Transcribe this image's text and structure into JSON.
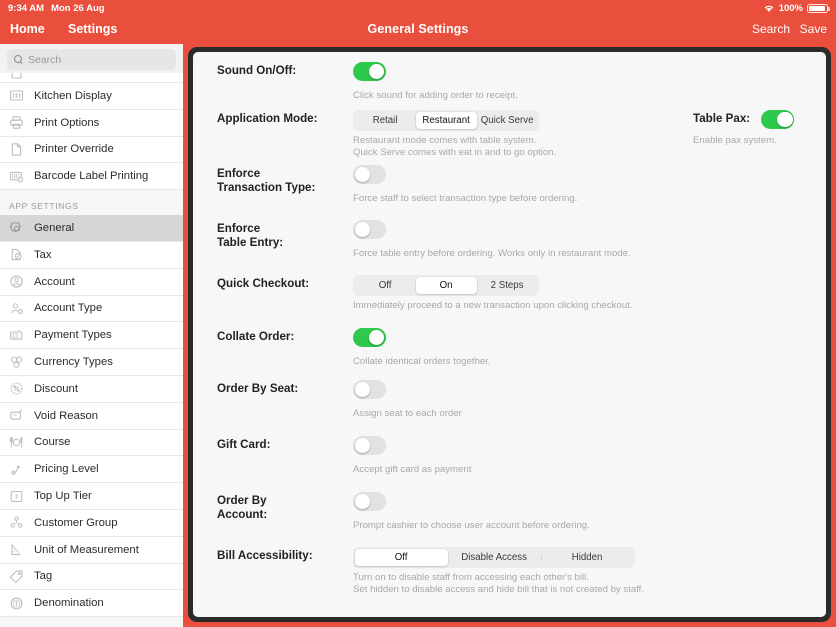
{
  "statusbar": {
    "time": "9:34 AM",
    "date": "Mon 26 Aug",
    "battery_percent": "100%",
    "wifi_icon": "wifi-icon",
    "battery_icon": "battery-icon"
  },
  "topbar": {
    "home_label": "Home",
    "settings_label": "Settings",
    "title": "General Settings",
    "search_label": "Search",
    "save_label": "Save",
    "accent_color": "#e94f3c"
  },
  "sidebar": {
    "search": {
      "placeholder": "Search",
      "icon": "search-icon"
    },
    "items": [
      {
        "label": "Kitchen Display",
        "icon": "kitchen-display-icon",
        "selected": false
      },
      {
        "label": "Print Options",
        "icon": "printer-icon",
        "selected": false
      },
      {
        "label": "Printer Override",
        "icon": "document-icon",
        "selected": false
      },
      {
        "label": "Barcode Label Printing",
        "icon": "barcode-icon",
        "selected": false
      }
    ],
    "group_label": "APP SETTINGS",
    "app_items": [
      {
        "label": "General",
        "icon": "gear-icon",
        "selected": true
      },
      {
        "label": "Tax",
        "icon": "tax-icon",
        "selected": false
      },
      {
        "label": "Account",
        "icon": "account-icon",
        "selected": false
      },
      {
        "label": "Account Type",
        "icon": "account-type-icon",
        "selected": false
      },
      {
        "label": "Payment Types",
        "icon": "payment-icon",
        "selected": false
      },
      {
        "label": "Currency Types",
        "icon": "currency-icon",
        "selected": false
      },
      {
        "label": "Discount",
        "icon": "discount-icon",
        "selected": false
      },
      {
        "label": "Void Reason",
        "icon": "void-reason-icon",
        "selected": false
      },
      {
        "label": "Course",
        "icon": "course-icon",
        "selected": false
      },
      {
        "label": "Pricing Level",
        "icon": "pricing-level-icon",
        "selected": false
      },
      {
        "label": "Top Up Tier",
        "icon": "top-up-tier-icon",
        "selected": false
      },
      {
        "label": "Customer Group",
        "icon": "customer-group-icon",
        "selected": false
      },
      {
        "label": "Unit of Measurement",
        "icon": "unit-measurement-icon",
        "selected": false
      },
      {
        "label": "Tag",
        "icon": "tag-icon",
        "selected": false
      },
      {
        "label": "Denomination",
        "icon": "denomination-icon",
        "selected": false
      }
    ]
  },
  "settings": {
    "sound": {
      "label": "Sound On/Off:",
      "help": "Click sound for adding order to receipt.",
      "state": "on"
    },
    "application_mode": {
      "label": "Application Mode:",
      "options": [
        "Retail",
        "Restaurant",
        "Quick Serve"
      ],
      "selected": "Restaurant",
      "help_line1": "Restaurant mode comes with table system.",
      "help_line2": "Quick Serve comes with eat in and to go option."
    },
    "table_pax": {
      "label": "Table Pax:",
      "help": "Enable pax system.",
      "state": "on"
    },
    "enforce_transaction_type": {
      "label_line1": "Enforce",
      "label_line2": "Transaction Type:",
      "help": "Force staff to select transaction type before ordering.",
      "state": "off"
    },
    "enforce_table_entry": {
      "label_line1": "Enforce",
      "label_line2": "Table Entry:",
      "help": "Force table entry before ordering. Works only in restaurant mode.",
      "state": "off"
    },
    "quick_checkout": {
      "label": "Quick Checkout:",
      "options": [
        "Off",
        "On",
        "2 Steps"
      ],
      "selected": "On",
      "help": "Immediately proceed to a new transaction upon clicking checkout."
    },
    "collate_order": {
      "label": "Collate Order:",
      "help": "Collate identical orders together.",
      "state": "on"
    },
    "order_by_seat": {
      "label": "Order By Seat:",
      "help": "Assign seat to each order",
      "state": "off"
    },
    "gift_card": {
      "label": "Gift Card:",
      "help": "Accept gift card as payment",
      "state": "off"
    },
    "order_by_account": {
      "label_line1": "Order By",
      "label_line2": "Account:",
      "help": "Prompt cashier to choose user account before ordering.",
      "state": "off"
    },
    "bill_accessibility": {
      "label": "Bill Accessibility:",
      "options": [
        "Off",
        "Disable Access",
        "Hidden"
      ],
      "selected": "Off",
      "help_line1": "Turn on to disable staff from accessing each other's bill.",
      "help_line2": "Set hidden to disable access and hide bill that is not created by staff."
    }
  },
  "colors": {
    "toggle_on": "#2ec84c",
    "toggle_off": "#e2e2e2",
    "header_red": "#e94f3c",
    "selected_row": "#d6d6d6"
  }
}
